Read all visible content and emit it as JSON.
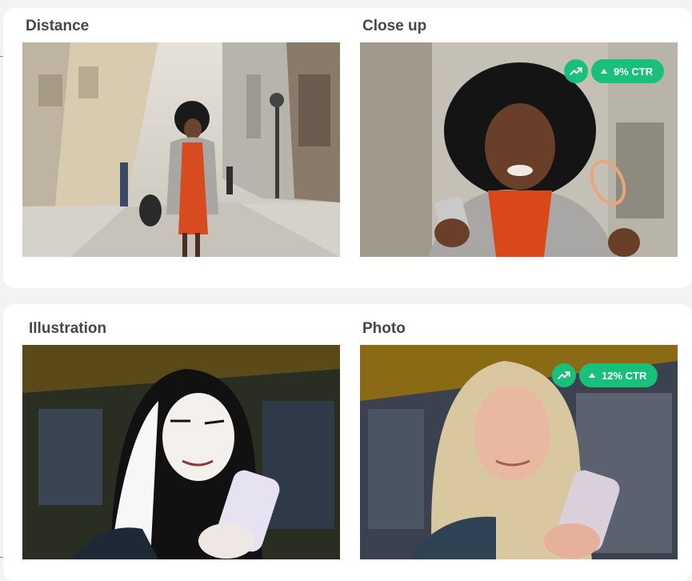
{
  "cards": [
    {
      "left": {
        "label": "Distance"
      },
      "right": {
        "label": "Close up",
        "ctr": "9% CTR"
      }
    },
    {
      "left": {
        "label": "Illustration"
      },
      "right": {
        "label": "Photo",
        "ctr": "12% CTR"
      }
    }
  ],
  "colors": {
    "badge": "#19c07a",
    "connector": "#2aa7e0"
  }
}
